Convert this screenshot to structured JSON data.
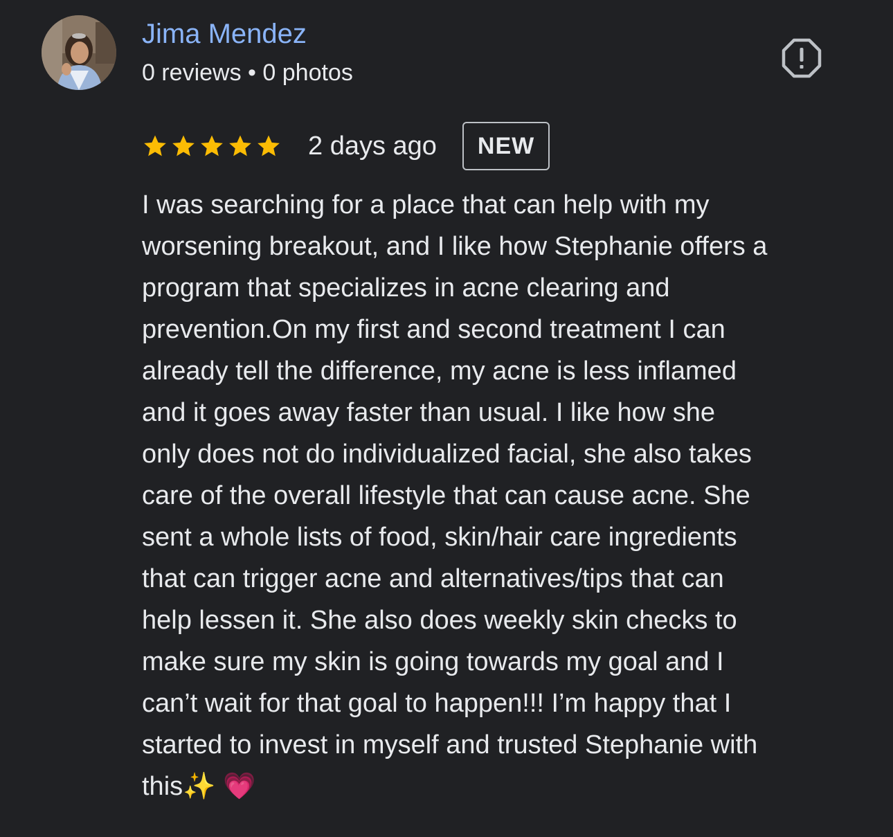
{
  "review": {
    "author": {
      "name": "Jima Mendez",
      "stats": "0 reviews • 0 photos"
    },
    "rating": 5,
    "rating_max": 5,
    "date": "2 days ago",
    "badge": "NEW",
    "text_lines": [
      "I was searching for a place that can help with my",
      "worsening breakout, and I like how Stephanie offers a",
      "program that specializes in acne clearing and",
      "prevention.On my first and second treatment I can",
      "already tell the difference, my acne is less inflamed",
      "and it goes away faster than usual. I like how she",
      "only does not do individualized facial, she also takes",
      "care of the overall lifestyle that can cause acne. She",
      "sent a whole lists of food, skin/hair care ingredients",
      "that can trigger acne and alternatives/tips that can",
      "help lessen it. She also does weekly skin checks to",
      "make sure my skin is going towards my goal and I",
      "can’t wait for that goal to happen!!! I’m happy that I",
      "started to invest in myself and trusted Stephanie with",
      "this"
    ],
    "text_emoji": [
      "✨",
      "💗"
    ]
  },
  "icons": {
    "avatar": "user-avatar-photo",
    "report": "report-flag-icon",
    "star": "star-icon"
  },
  "colors": {
    "background": "#202124",
    "author_name": "#8ab4f8",
    "text": "#e8eaed",
    "star": "#fbbc04",
    "icon": "#bdc1c6"
  }
}
